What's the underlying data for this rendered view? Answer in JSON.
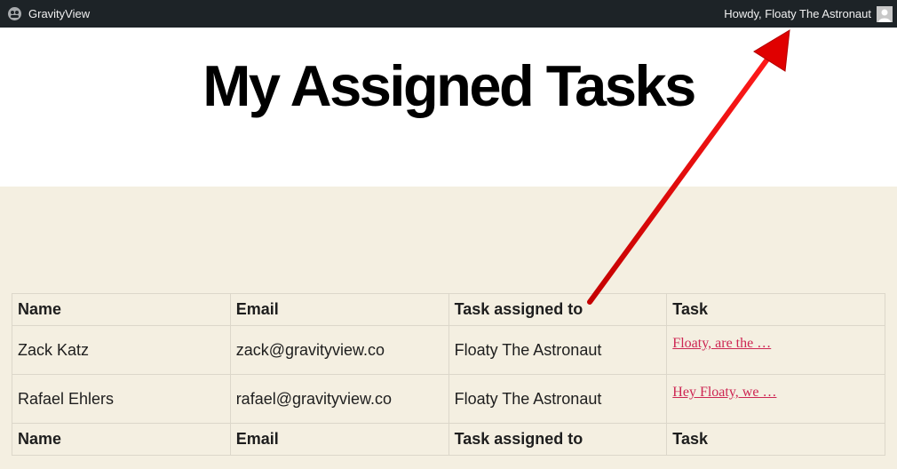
{
  "adminbar": {
    "site_name": "GravityView",
    "greeting": "Howdy, Floaty The Astronaut"
  },
  "page": {
    "title": "My Assigned Tasks"
  },
  "table": {
    "headers": [
      "Name",
      "Email",
      "Task assigned to",
      "Task"
    ],
    "rows": [
      {
        "name": "Zack Katz",
        "email": "zack@gravityview.co",
        "assigned_to": "Floaty The Astronaut",
        "task": "Floaty, are the …"
      },
      {
        "name": "Rafael Ehlers",
        "email": "rafael@gravityview.co",
        "assigned_to": "Floaty The Astronaut",
        "task": "Hey Floaty, we …"
      }
    ],
    "footers": [
      "Name",
      "Email",
      "Task assigned to",
      "Task"
    ]
  },
  "colors": {
    "adminbar_bg": "#1d2327",
    "content_bg": "#f4efe1",
    "link": "#cd2653",
    "annotation_arrow": "#e00000"
  },
  "icons": {
    "site": "gravityview-logo-icon",
    "avatar": "user-avatar-icon"
  }
}
